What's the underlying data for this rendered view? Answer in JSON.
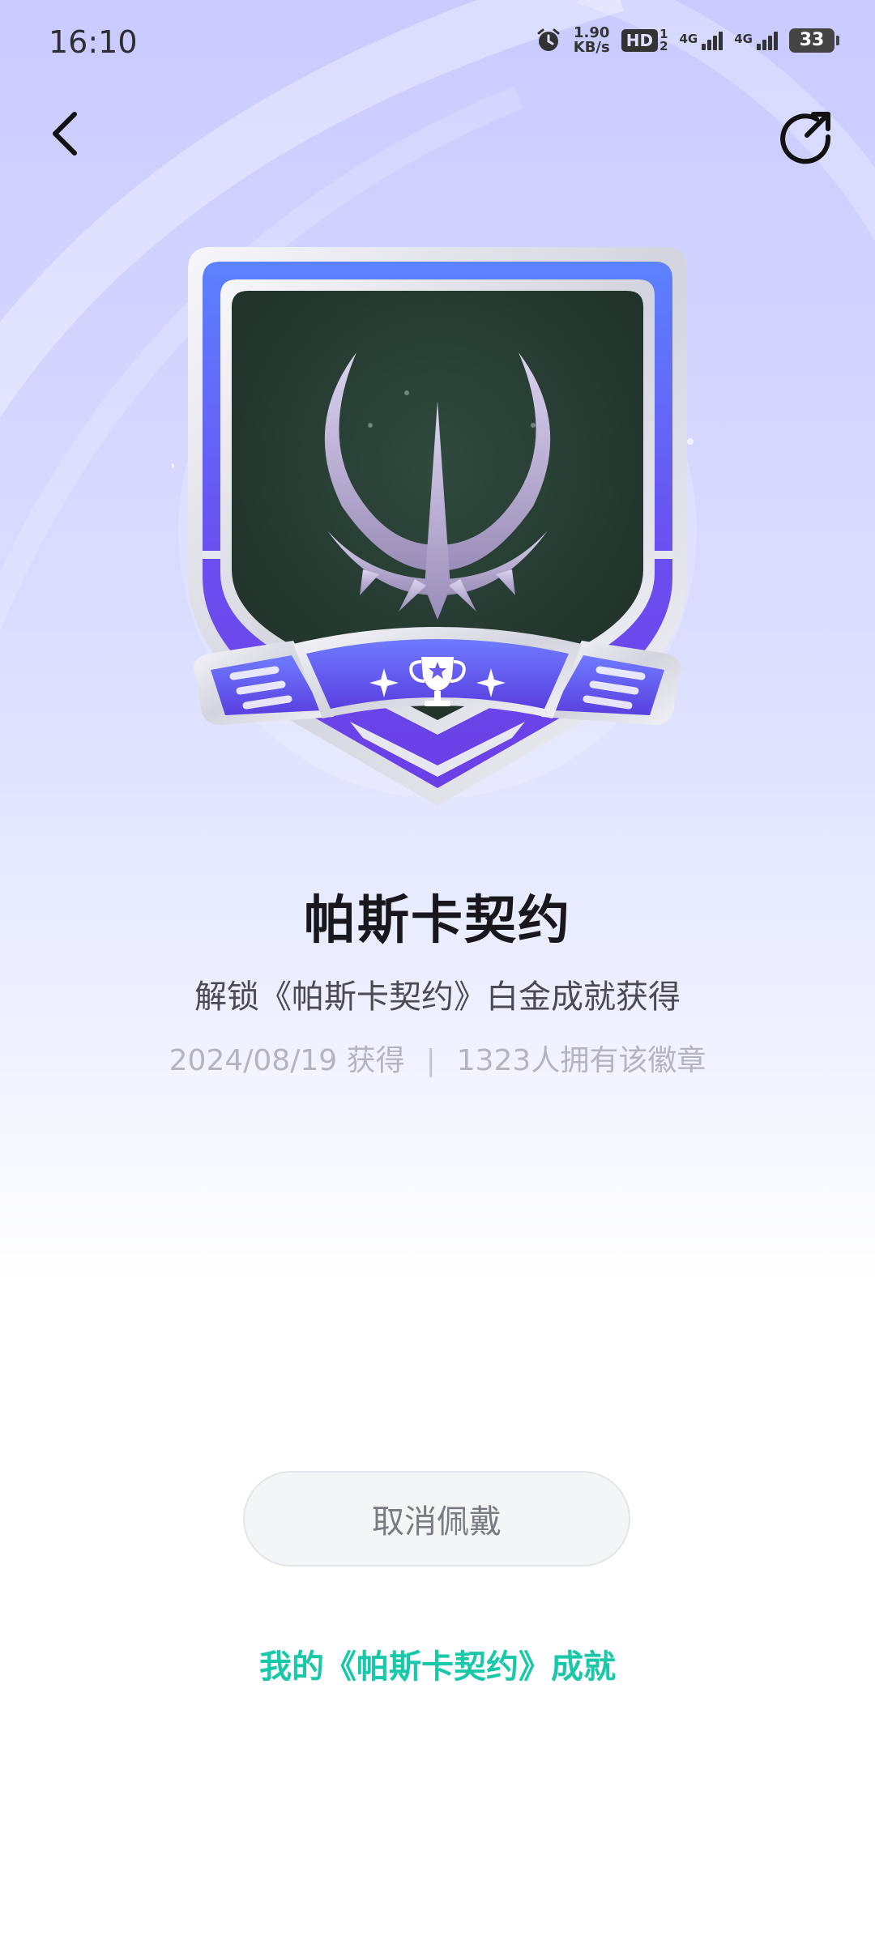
{
  "status_bar": {
    "time": "16:10",
    "net_speed_value": "1.90",
    "net_speed_unit": "KB/s",
    "hd_label": "HD",
    "hd_sub": "1",
    "hd_sub2": "2",
    "sim1_label": "4G",
    "sim2_label": "4G",
    "battery_level": "33",
    "icons": [
      "alarm-icon",
      "hd-voice-icon",
      "signal-icon",
      "battery-icon"
    ]
  },
  "nav": {
    "back_icon": "chevron-left-icon",
    "share_icon": "share-icon"
  },
  "badge": {
    "name": "帕斯卡契约",
    "description": "解锁《帕斯卡契约》白金成就获得",
    "date": "2024/08/19 获得",
    "separator": "|",
    "owners": "1323人拥有该徽章",
    "emblem_icon": "crescent-sword-icon",
    "ribbon_icon": "trophy-icon",
    "colors": {
      "frame_blue": "#5b7bff",
      "frame_purple": "#6a45e8",
      "inner_dark": "#253a30",
      "silver": "#e2e3ea"
    }
  },
  "actions": {
    "unwear_label": "取消佩戴",
    "achievements_link": "我的《帕斯卡契约》成就",
    "link_color": "#19c7a9"
  }
}
